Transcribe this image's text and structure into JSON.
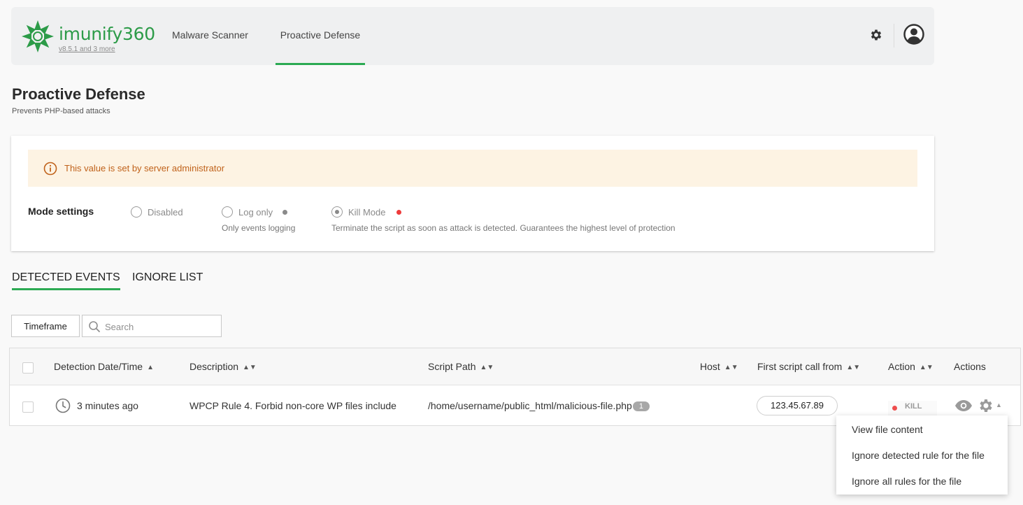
{
  "header": {
    "brand": "imunify360",
    "version": "v8.5.1 and 3 more",
    "nav": [
      "Malware Scanner",
      "Proactive Defense"
    ],
    "active_nav": "Proactive Defense",
    "icons": [
      "settings-gear-icon",
      "user-avatar-icon"
    ]
  },
  "page": {
    "title": "Proactive Defense",
    "subtitle": "Prevents PHP-based attacks"
  },
  "warning": {
    "text": "This value is set by server administrator",
    "icon": "info-circle-icon",
    "color": "#c0621b"
  },
  "mode": {
    "label": "Mode settings",
    "selected": "Kill Mode",
    "options": [
      {
        "label": "Disabled",
        "desc": ""
      },
      {
        "label": "Log only",
        "desc": "Only events logging",
        "dot_color": "#8a8a8a"
      },
      {
        "label": "Kill Mode",
        "desc": "Terminate the script as soon as attack is detected. Guarantees the highest level of protection",
        "dot_color": "#ee3b3b"
      }
    ]
  },
  "tabs": [
    "DETECTED EVENTS",
    "IGNORE LIST"
  ],
  "active_tab": "DETECTED EVENTS",
  "filters": {
    "timeframe_label": "Timeframe",
    "search_placeholder": "Search"
  },
  "table": {
    "columns": [
      "Detection Date/Time",
      "Description",
      "Script Path",
      "Host",
      "First script call from",
      "Action",
      "Actions"
    ],
    "sort_icons": [
      "▲",
      "▲▼",
      "▲▼",
      "▲▼",
      "▲▼",
      "▲▼"
    ],
    "rows": [
      {
        "time": "3 minutes ago",
        "description": "WPCP Rule 4. Forbid non-core WP files include",
        "script_path": "/home/username/public_html/malicious-file.php",
        "path_count": "1",
        "host": "",
        "first_call_from": "123.45.67.89",
        "action": "KILL"
      }
    ]
  },
  "row_menu": {
    "items": [
      "View file content",
      "Ignore detected rule for the file",
      "Ignore all rules for the file"
    ]
  },
  "colors": {
    "brand_green": "#2c9b48",
    "accent_green": "#2caa53",
    "kill_red": "#ee4d4d"
  }
}
